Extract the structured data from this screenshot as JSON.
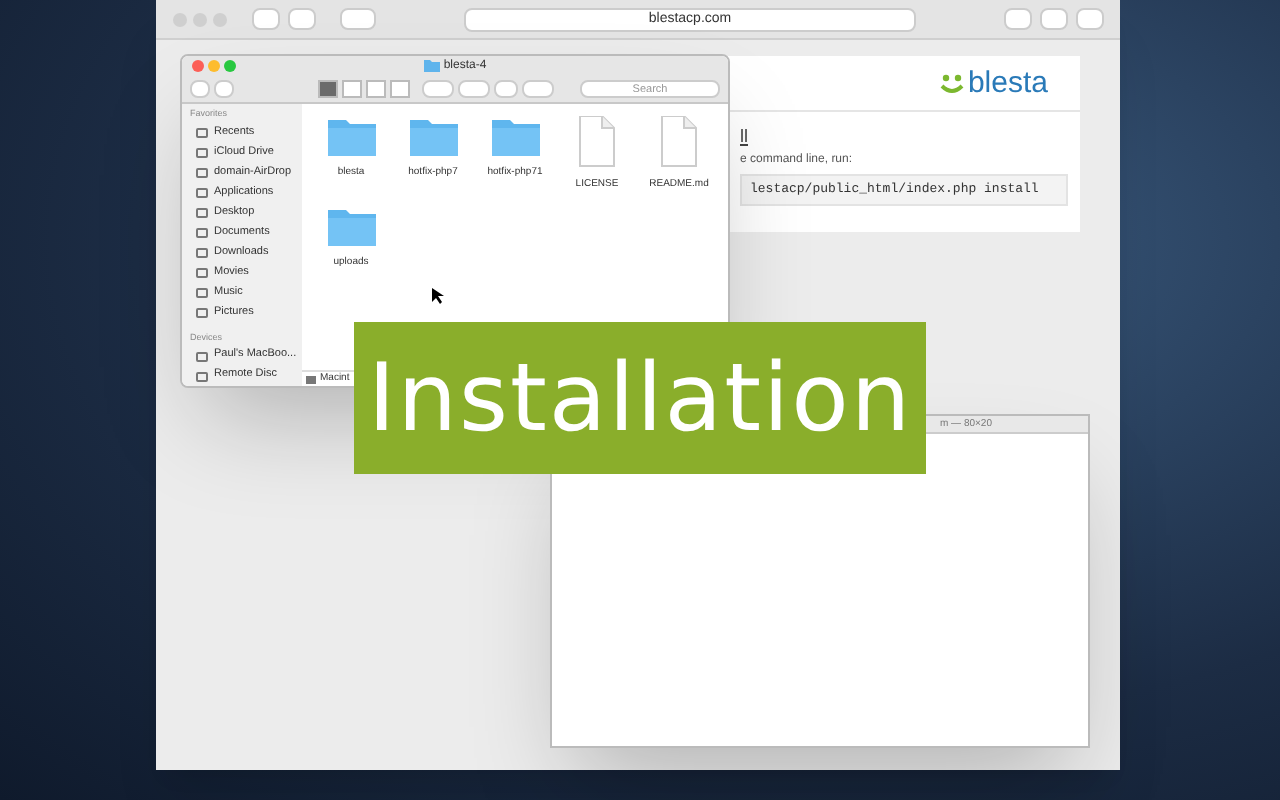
{
  "browser": {
    "address": "blestacp.com",
    "page": {
      "logo": "blesta",
      "heading": "ll",
      "instruction": "e command line, run:",
      "command": "lestacp/public_html/index.php install"
    }
  },
  "finder": {
    "title": "blesta-4",
    "search": {
      "placeholder": "Search"
    },
    "view_modes": [
      {
        "selected": true
      },
      {
        "selected": false
      },
      {
        "selected": false
      },
      {
        "selected": false
      }
    ],
    "sidebar": [
      {
        "heading": "Favorites",
        "items": [
          {
            "label": "Recents"
          },
          {
            "label": "iCloud Drive"
          },
          {
            "label": "domain-AirDrop"
          },
          {
            "label": "Applications"
          },
          {
            "label": "Desktop"
          },
          {
            "label": "Documents"
          },
          {
            "label": "Downloads"
          },
          {
            "label": "Movies"
          },
          {
            "label": "Music"
          },
          {
            "label": "Pictures"
          }
        ]
      },
      {
        "heading": "Devices",
        "items": [
          {
            "label": "Paul's MacBoo..."
          },
          {
            "label": "Remote Disc"
          }
        ]
      }
    ],
    "files": [
      {
        "name": "blesta",
        "kind": "folder"
      },
      {
        "name": "hotfix-php7",
        "kind": "folder"
      },
      {
        "name": "hotfix-php71",
        "kind": "folder"
      },
      {
        "name": "LICENSE",
        "kind": "document"
      },
      {
        "name": "README.md",
        "kind": "document"
      },
      {
        "name": "uploads",
        "kind": "folder"
      }
    ],
    "path_bar": "Macint"
  },
  "terminal": {
    "title": "m — 80×20"
  },
  "overlay": {
    "title": "Installation"
  }
}
